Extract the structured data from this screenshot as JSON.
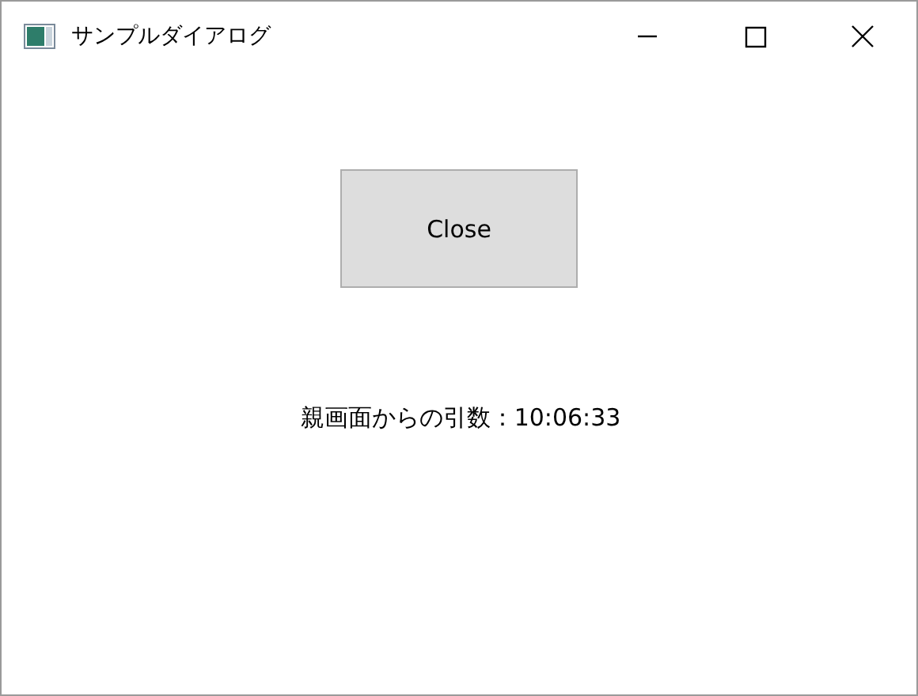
{
  "window": {
    "title": "サンプルダイアログ"
  },
  "close_button": {
    "label": "Close"
  },
  "message": "親画面からの引数：10:06:33"
}
